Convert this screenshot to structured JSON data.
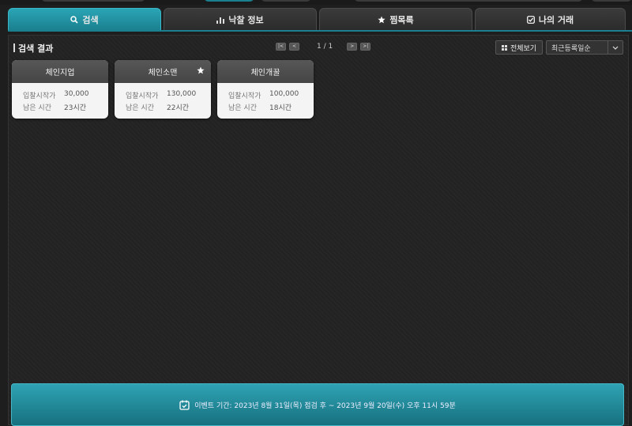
{
  "tabs": [
    {
      "label": "검색",
      "icon": "search-icon",
      "active": true
    },
    {
      "label": "낙찰 정보",
      "icon": "bar-chart-icon",
      "active": false
    },
    {
      "label": "찜목록",
      "icon": "star-icon",
      "active": false
    },
    {
      "label": "나의 거래",
      "icon": "checkbox-icon",
      "active": false
    }
  ],
  "panel": {
    "title": "검색 결과",
    "pager": {
      "current": "1 / 1"
    },
    "view_all_label": "전체보기",
    "sort_selected": "최근등록일순"
  },
  "cards": [
    {
      "name": "체인지업",
      "start_bid_label": "입찰시작가",
      "start_bid": "30,000",
      "time_left_label": "남은 시간",
      "time_left": "23시간",
      "starred": false
    },
    {
      "name": "체인소맨",
      "start_bid_label": "입찰시작가",
      "start_bid": "130,000",
      "time_left_label": "남은 시간",
      "time_left": "22시간",
      "starred": true
    },
    {
      "name": "체인개꿀",
      "start_bid_label": "입찰시작가",
      "start_bid": "100,000",
      "time_left_label": "남은 시간",
      "time_left": "18시간",
      "starred": false
    }
  ],
  "footer": {
    "event_text": "이벤트 기간: 2023년 8월 31일(목) 점검 후 ~ 2023년 9월 20일(수) 오후 11시 59분"
  },
  "colors": {
    "accent": "#1a7f8e",
    "background": "#1e1e1e",
    "card": "#f4f4f4"
  }
}
